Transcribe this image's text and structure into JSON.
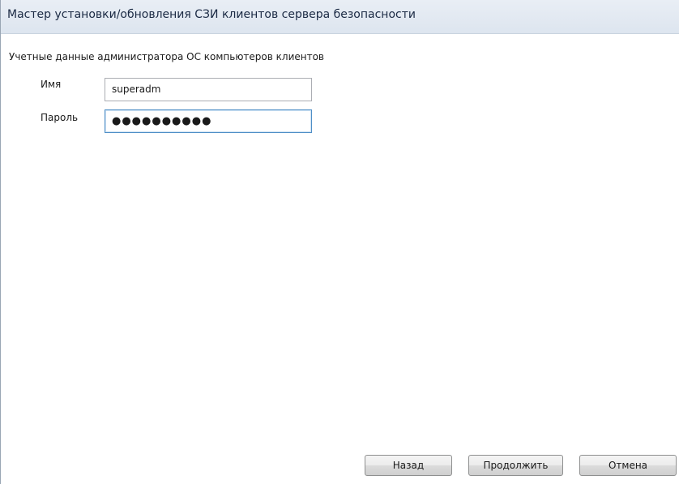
{
  "window": {
    "title": "Мастер установки/обновления СЗИ клиентов сервера безопасности"
  },
  "form": {
    "section_label": "Учетные данные администратора ОС компьютеров клиентов",
    "name_label": "Имя",
    "name_value": "superadm",
    "password_label": "Пароль",
    "password_value": "●●●●●●●●●●"
  },
  "buttons": {
    "back": "Назад",
    "continue": "Продолжить",
    "cancel": "Отмена"
  }
}
